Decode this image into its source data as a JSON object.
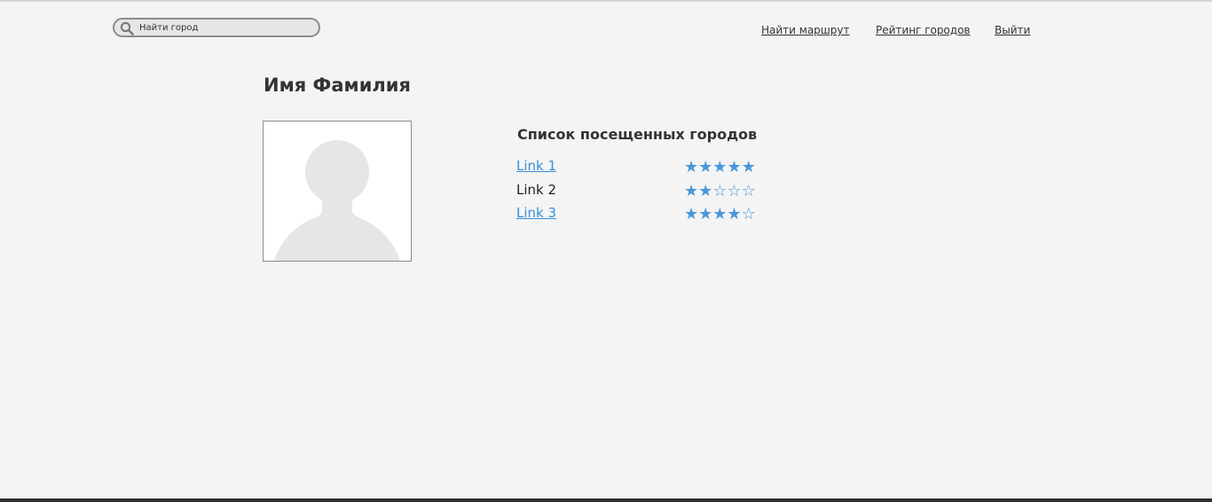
{
  "header": {
    "search": {
      "placeholder": "Найти город"
    },
    "nav": [
      {
        "label": "Найти маршрут"
      },
      {
        "label": "Рейтинг городов"
      },
      {
        "label": "Выйти"
      }
    ]
  },
  "profile": {
    "name": "Имя Фамилия",
    "avatar_icon": "user-silhouette-icon"
  },
  "visited": {
    "title": "Список посещенных городов",
    "items": [
      {
        "label": "Link 1",
        "is_link": true,
        "rating": 5,
        "max": 5
      },
      {
        "label": "Link 2",
        "is_link": false,
        "rating": 2,
        "max": 5
      },
      {
        "label": "Link 3",
        "is_link": true,
        "rating": 4,
        "max": 5
      }
    ]
  },
  "colors": {
    "background": "#f4f4f4",
    "link": "#3a8ed6",
    "star": "#4a97d8",
    "text": "#333333",
    "footer_bar": "#2d3033"
  }
}
